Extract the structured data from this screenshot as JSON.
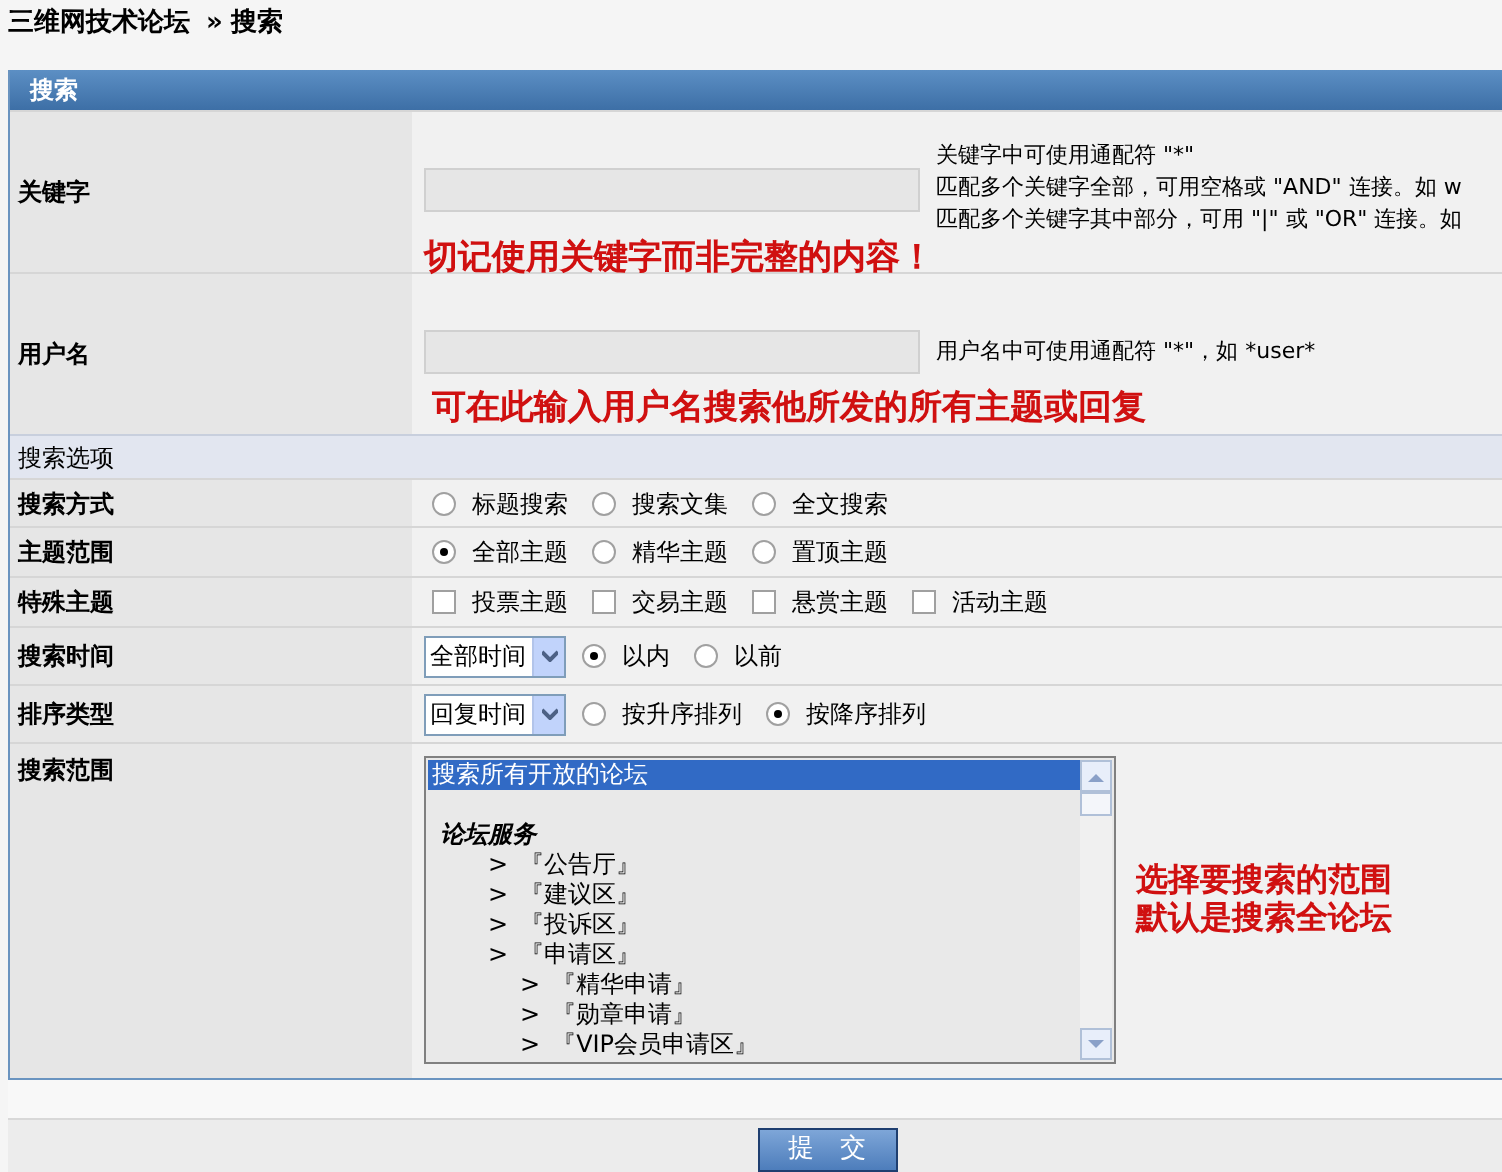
{
  "breadcrumb": {
    "site": "三维网技术论坛",
    "separator": "»",
    "page": "搜索"
  },
  "panel": {
    "title": "搜索"
  },
  "keyword": {
    "label": "关键字",
    "hints": [
      "关键字中可使用通配符 \"*\"",
      "匹配多个关键字全部，可用空格或 \"AND\" 连接。如 w",
      "匹配多个关键字其中部分，可用 \"|\" 或 \"OR\" 连接。如"
    ],
    "note": "切记使用关键字而非完整的内容！"
  },
  "username": {
    "label": "用户名",
    "hint": "用户名中可使用通配符 \"*\"，如 *user*",
    "note": "可在此输入用户名搜索他所发的所有主题或回复"
  },
  "options_header": "搜索选项",
  "rows": [
    {
      "label": "搜索方式",
      "kind": "radios",
      "options": [
        {
          "label": "标题搜索",
          "selected": false
        },
        {
          "label": "搜索文集",
          "selected": false
        },
        {
          "label": "全文搜索",
          "selected": false
        }
      ]
    },
    {
      "label": "主题范围",
      "kind": "radios",
      "options": [
        {
          "label": "全部主题",
          "selected": true
        },
        {
          "label": "精华主题",
          "selected": false
        },
        {
          "label": "置顶主题",
          "selected": false
        }
      ]
    },
    {
      "label": "特殊主题",
      "kind": "checkboxes",
      "options": [
        {
          "label": "投票主题",
          "checked": false
        },
        {
          "label": "交易主题",
          "checked": false
        },
        {
          "label": "悬赏主题",
          "checked": false
        },
        {
          "label": "活动主题",
          "checked": false
        }
      ]
    },
    {
      "label": "搜索时间",
      "kind": "select_radios",
      "select": "全部时间",
      "options": [
        {
          "label": "以内",
          "selected": true
        },
        {
          "label": "以前",
          "selected": false
        }
      ]
    },
    {
      "label": "排序类型",
      "kind": "select_radios",
      "select": "回复时间",
      "options": [
        {
          "label": "按升序排列",
          "selected": false
        },
        {
          "label": "按降序排列",
          "selected": true
        }
      ]
    }
  ],
  "scope": {
    "label": "搜索范围",
    "items": [
      {
        "kind": "option",
        "label": "搜索所有开放的论坛",
        "selected": true
      },
      {
        "kind": "group",
        "label": "论坛服务",
        "children": [
          {
            "kind": "forum",
            "marker": ">",
            "label": "『公告厅』"
          },
          {
            "kind": "forum",
            "marker": ">",
            "label": "『建议区』"
          },
          {
            "kind": "forum",
            "marker": ">",
            "label": "『投诉区』"
          },
          {
            "kind": "forum",
            "marker": ">",
            "label": "『申请区』",
            "children": [
              {
                "kind": "forum",
                "marker": ">",
                "label": "『精华申请』"
              },
              {
                "kind": "forum",
                "marker": ">",
                "label": "『勋章申请』"
              },
              {
                "kind": "forum",
                "marker": ">",
                "label": "『VIP会员申请区』"
              }
            ]
          }
        ]
      }
    ],
    "note": [
      "选择要搜索的范围",
      "默认是搜索全论坛"
    ]
  },
  "submit": "提　交"
}
